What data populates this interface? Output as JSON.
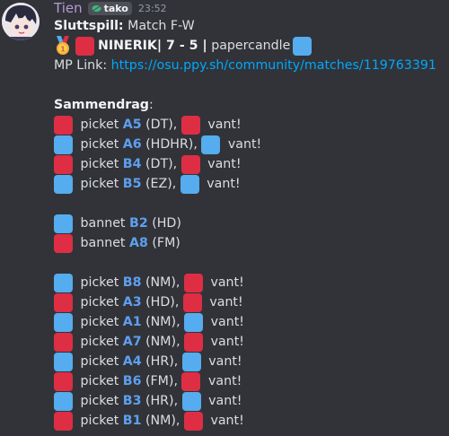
{
  "colors": {
    "red": "#dd2e44",
    "blue": "#55acee",
    "username": "#b69ad6",
    "link": "#00a8fc",
    "map": "#5e9ff0"
  },
  "header": {
    "username": "Tien",
    "tag": "tako",
    "time": "23:52",
    "tag_icon": "leaf-icon"
  },
  "match": {
    "stage_label": "Sluttspill:",
    "stage_value": " Match F-W",
    "team_red": "NINERIK",
    "score": "| 7 - 5 |",
    "team_blue": " papercandle",
    "medal_icon": "gold-medal-icon",
    "mp_label": "MP Link: ",
    "mp_url": "https://osu.ppy.sh/community/matches/119763391"
  },
  "summary_label": "Sammendrag",
  "summary_colon": ":",
  "picks_a": [
    {
      "team": "red",
      "pre": " picket ",
      "map": "A5",
      "mod": " (DT), ",
      "winner": "red",
      "won": " vant!"
    },
    {
      "team": "blue",
      "pre": " picket ",
      "map": "A6",
      "mod": " (HDHR), ",
      "winner": "blue",
      "won": " vant!"
    },
    {
      "team": "red",
      "pre": " picket ",
      "map": "B4",
      "mod": " (DT), ",
      "winner": "red",
      "won": " vant!"
    },
    {
      "team": "blue",
      "pre": " picket ",
      "map": "B5",
      "mod": " (EZ), ",
      "winner": "blue",
      "won": " vant!"
    }
  ],
  "bans": [
    {
      "team": "blue",
      "pre": " bannet ",
      "map": "B2",
      "mod": " (HD)"
    },
    {
      "team": "red",
      "pre": " bannet ",
      "map": "A8",
      "mod": " (FM)"
    }
  ],
  "picks_b": [
    {
      "team": "blue",
      "pre": " picket ",
      "map": "B8",
      "mod": " (NM), ",
      "winner": "red",
      "won": " vant!"
    },
    {
      "team": "red",
      "pre": " picket ",
      "map": "A3",
      "mod": " (HD), ",
      "winner": "red",
      "won": " vant!"
    },
    {
      "team": "blue",
      "pre": " picket ",
      "map": "A1",
      "mod": " (NM), ",
      "winner": "blue",
      "won": " vant!"
    },
    {
      "team": "red",
      "pre": " picket ",
      "map": "A7",
      "mod": " (NM), ",
      "winner": "red",
      "won": " vant!"
    },
    {
      "team": "blue",
      "pre": " picket ",
      "map": "A4",
      "mod": " (HR), ",
      "winner": "blue",
      "won": " vant!"
    },
    {
      "team": "red",
      "pre": " picket ",
      "map": "B6",
      "mod": " (FM), ",
      "winner": "red",
      "won": " vant!"
    },
    {
      "team": "blue",
      "pre": " picket ",
      "map": "B3",
      "mod": " (HR), ",
      "winner": "blue",
      "won": " vant!"
    },
    {
      "team": "red",
      "pre": " picket ",
      "map": "B1",
      "mod": " (NM), ",
      "winner": "red",
      "won": " vant!"
    }
  ]
}
